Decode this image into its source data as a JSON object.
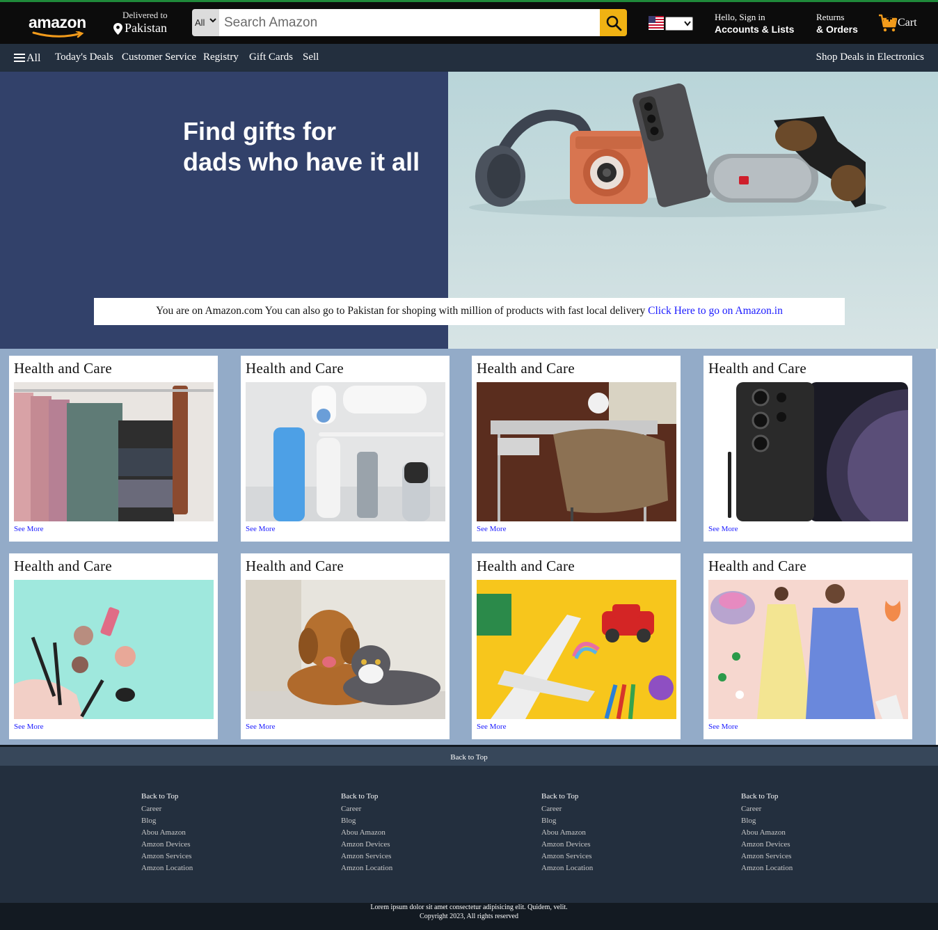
{
  "header": {
    "logo_text": "amazon",
    "deliver_label": "Delivered to",
    "deliver_location": "Pakistan",
    "search_category": "All",
    "search_placeholder": "Search Amazon",
    "account_line1": "Hello, Sign in",
    "account_line2": "Accounts & Lists",
    "returns_line1": "Returns",
    "returns_line2": "& Orders",
    "cart_label": "Cart"
  },
  "subnav": {
    "all": "All",
    "items": [
      "Today's Deals",
      "Customer Service",
      "Registry",
      "Gift Cards",
      "Sell"
    ],
    "right": "Shop Deals in Electronics"
  },
  "hero": {
    "title_line1": "Find gifts for",
    "title_line2": "dads who have it all",
    "notice_text": "You are on Amazon.com You can also go to Pakistan for shoping with million of products with fast local delivery ",
    "notice_link": "Click Here to go on Amazon.in"
  },
  "cards": [
    {
      "title": "Health and Care",
      "more": "See More",
      "image": "clothes-hanger-photo"
    },
    {
      "title": "Health and Care",
      "more": "See More",
      "image": "toiletries-photo"
    },
    {
      "title": "Health and Care",
      "more": "See More",
      "image": "desk-chair-photo"
    },
    {
      "title": "Health and Care",
      "more": "See More",
      "image": "smartphone-photo"
    },
    {
      "title": "Health and Care",
      "more": "See More",
      "image": "makeup-photo"
    },
    {
      "title": "Health and Care",
      "more": "See More",
      "image": "dog-cat-photo"
    },
    {
      "title": "Health and Care",
      "more": "See More",
      "image": "toys-photo"
    },
    {
      "title": "Health and Care",
      "more": "See More",
      "image": "fashion-photo"
    }
  ],
  "footer": {
    "back_to_top": "Back to Top",
    "columns": [
      {
        "head": "Back to Top",
        "links": [
          "Career",
          "Blog",
          "Abou Amazon",
          "Amzon Devices",
          "Amzon Services",
          "Amzon Location"
        ]
      },
      {
        "head": "Back to Top",
        "links": [
          "Career",
          "Blog",
          "Abou Amazon",
          "Amzon Devices",
          "Amzon Services",
          "Amzon Location"
        ]
      },
      {
        "head": "Back to Top",
        "links": [
          "Career",
          "Blog",
          "Abou Amazon",
          "Amzon Devices",
          "Amzon Services",
          "Amzon Location"
        ]
      },
      {
        "head": "Back to Top",
        "links": [
          "Career",
          "Blog",
          "Abou Amazon",
          "Amzon Devices",
          "Amzon Services",
          "Amzon Location"
        ]
      }
    ],
    "copy_line1": "Lorem ipsum dolor sit amet consectetur adipisicing elit. Quidem, velit.",
    "copy_line2": "Copyright 2023, All rights reserved"
  },
  "colors": {
    "nav_bg": "#0c0c0c",
    "subnav_bg": "#232f3e",
    "search_button": "#f0b213",
    "hero_left": "#32416a",
    "grid_bg": "#93abc8",
    "link": "#1a1aff"
  }
}
